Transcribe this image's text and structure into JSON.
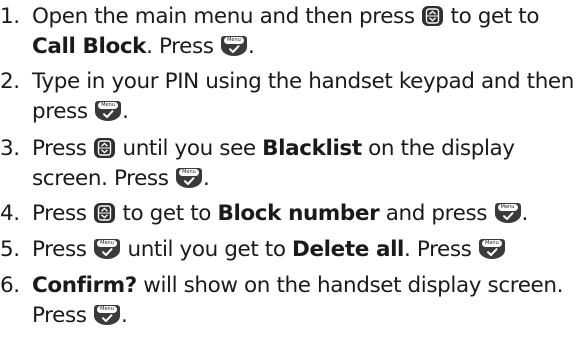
{
  "menu_key_label": "Menu",
  "steps": [
    {
      "num": "1.",
      "t1": "Open the main menu and then press",
      "t2": "to get to",
      "b1": "Call Block",
      "t3": ". Press",
      "t4": "."
    },
    {
      "num": "2.",
      "t1": "Type in your PIN using the handset keypad and then",
      "t2": "press",
      "t3": "."
    },
    {
      "num": "3.",
      "t1": "Press",
      "t2": "until you see",
      "b1": "Blacklist",
      "t3": "on the display",
      "t4": "screen. Press",
      "t5": "."
    },
    {
      "num": "4.",
      "t1": "Press",
      "t2": "to get to",
      "b1": "Block number",
      "t3": "and press",
      "t4": "."
    },
    {
      "num": "5.",
      "t1": "Press",
      "t2": "until you get to",
      "b1": "Delete all",
      "t3": ". Press"
    },
    {
      "num": "6.",
      "b1": "Confirm?",
      "t1": "will show on the handset display screen.",
      "t2": "Press",
      "t3": "."
    }
  ]
}
